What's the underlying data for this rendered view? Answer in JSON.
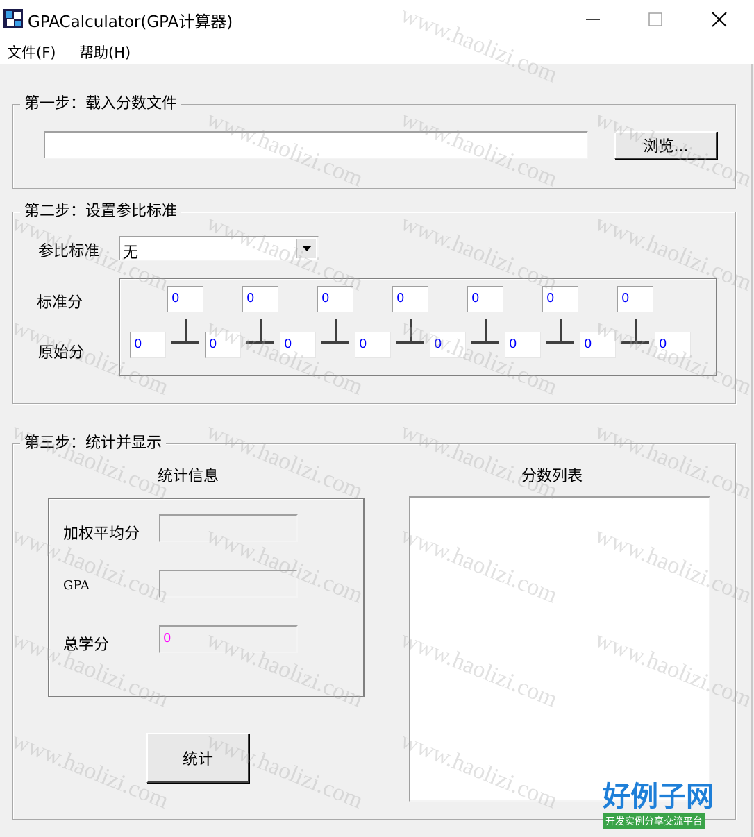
{
  "window": {
    "title": "GPACalculator(GPA计算器)",
    "minimize_icon": "minimize-icon",
    "maximize_icon": "maximize-icon",
    "close_icon": "close-icon"
  },
  "menu": {
    "items": [
      {
        "label": "文件(F)"
      },
      {
        "label": "帮助(H)"
      }
    ]
  },
  "step1": {
    "title": "第一步：载入分数文件",
    "file_path": "",
    "browse_label": "浏览..."
  },
  "step2": {
    "title": "第二步：设置参比标准",
    "standard_label": "参比标准",
    "standard_selected": "无",
    "standard_score_label": "标准分",
    "raw_score_label": "原始分",
    "standard_scores": [
      "0",
      "0",
      "0",
      "0",
      "0",
      "0",
      "0"
    ],
    "raw_scores": [
      "0",
      "0",
      "0",
      "0",
      "0",
      "0",
      "0",
      "0"
    ]
  },
  "step3": {
    "title": "第三步：统计并显示",
    "stats_heading": "统计信息",
    "list_heading": "分数列表",
    "weighted_avg_label": "加权平均分",
    "weighted_avg_value": "",
    "gpa_label": "GPA",
    "gpa_value": "",
    "total_credit_label": "总学分",
    "total_credit_value": "0",
    "compute_label": "统计"
  },
  "watermark": {
    "text": "www.haolizi.com",
    "brand": "好例子网",
    "brand_sub": "开发实例分享交流平台"
  },
  "colors": {
    "value_blue": "#0000ff",
    "value_magenta": "#ff00ff"
  }
}
